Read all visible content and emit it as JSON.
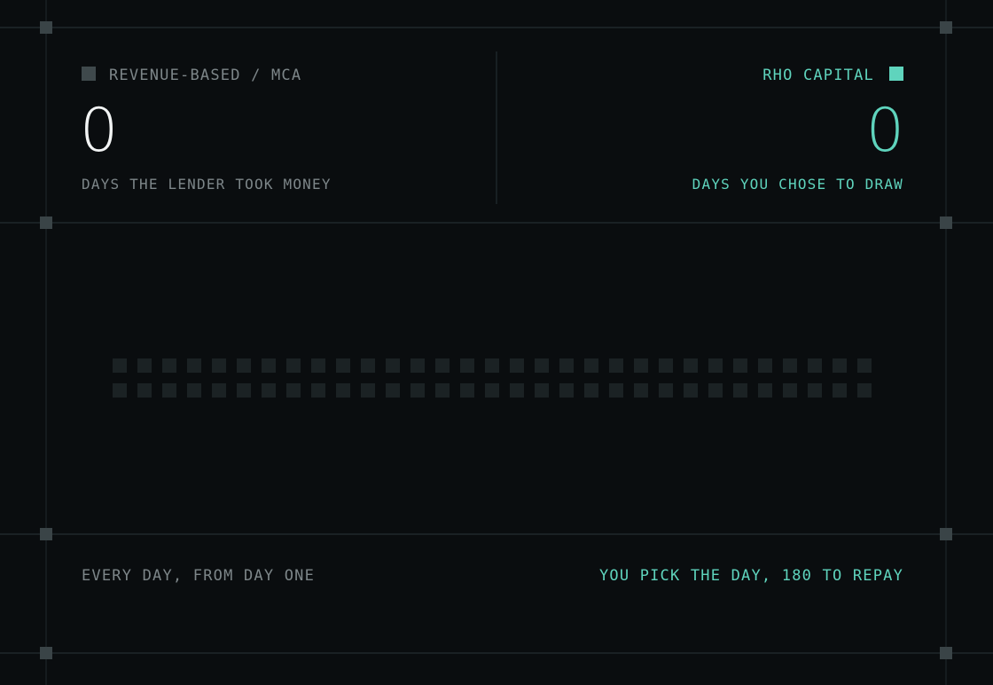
{
  "left_panel": {
    "title": "REVENUE-BASED / MCA",
    "count": "0",
    "caption": "DAYS THE LENDER TOOK MONEY",
    "footer": "EVERY DAY, FROM DAY ONE"
  },
  "right_panel": {
    "title": "RHO CAPITAL",
    "count": "0",
    "caption": "DAYS YOU CHOSE TO DRAW",
    "footer": "YOU PICK THE DAY, 180 TO REPAY"
  },
  "day_grid": {
    "rows": 2,
    "columns": 31,
    "filled_days": 0
  },
  "colors": {
    "background": "#0a0d0f",
    "accent": "#5fd4bd",
    "muted": "#7d8689",
    "empty_cell": "#1b2224",
    "left_swatch": "#3f494c"
  }
}
